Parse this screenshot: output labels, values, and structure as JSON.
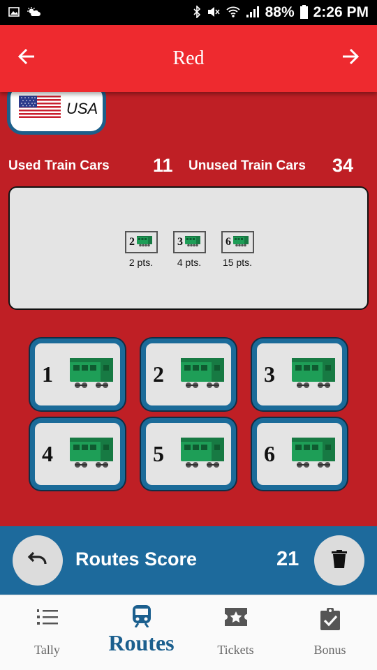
{
  "status": {
    "battery": "88%",
    "time": "2:26 PM"
  },
  "header": {
    "title": "Red",
    "back_icon": "arrow-left-icon",
    "forward_icon": "arrow-right-icon"
  },
  "country": {
    "name": "USA",
    "flag_icon": "us-flag-icon"
  },
  "counts": {
    "used_label": "Used Train Cars",
    "used_value": "11",
    "unused_label": "Unused Train Cars",
    "unused_value": "34"
  },
  "routes_played": [
    {
      "length": "2",
      "points": "2 pts."
    },
    {
      "length": "3",
      "points": "4 pts."
    },
    {
      "length": "6",
      "points": "15 pts."
    }
  ],
  "route_buttons": [
    "1",
    "2",
    "3",
    "4",
    "5",
    "6"
  ],
  "score": {
    "label": "Routes Score",
    "value": "21",
    "undo_icon": "undo-icon",
    "clear_icon": "trash-icon"
  },
  "nav": [
    {
      "label": "Tally",
      "icon": "numbered-list-icon",
      "active": false
    },
    {
      "label": "Routes",
      "icon": "train-icon",
      "active": true
    },
    {
      "label": "Tickets",
      "icon": "ticket-star-icon",
      "active": false
    },
    {
      "label": "Bonus",
      "icon": "clipboard-check-icon",
      "active": false
    }
  ],
  "colors": {
    "background": "#bf1f25",
    "appbar": "#ee2a2f",
    "accent_blue": "#1d6a9c",
    "train_green": "#1e9e57"
  }
}
